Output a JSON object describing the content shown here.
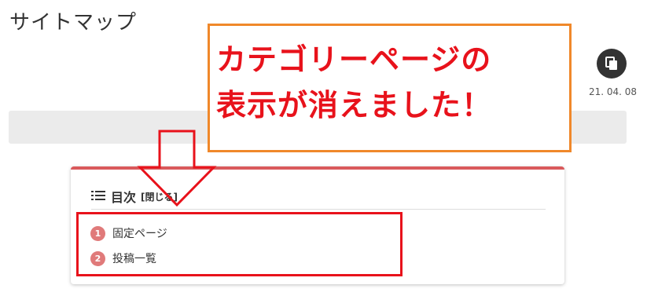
{
  "page": {
    "title": "サイトマップ",
    "date": "21. 04. 08"
  },
  "callout": {
    "line1": "カテゴリーページの",
    "line2": "表示が消えました！"
  },
  "toc": {
    "title": "目次",
    "toggle_label": "[閉じる]",
    "items": [
      {
        "number": "1",
        "label": "固定ページ"
      },
      {
        "number": "2",
        "label": "投稿一覧"
      }
    ]
  },
  "colors": {
    "callout_border": "#f0882a",
    "callout_text": "#e8121b",
    "toc_accent": "#d9595b",
    "toc_number_bg": "#e07a7a",
    "highlight_box": "#e8121b"
  },
  "icons": {
    "copy": "copy-icon",
    "list": "list-icon",
    "arrow": "down-arrow-icon"
  }
}
